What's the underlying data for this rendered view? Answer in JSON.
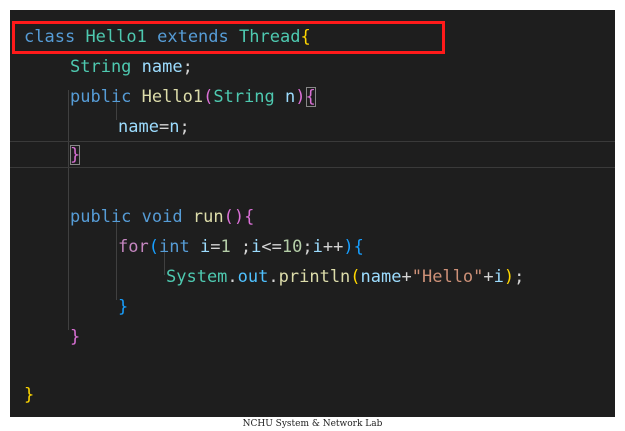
{
  "colors": {
    "background": "#1e1e1e",
    "keyword": "#569cd6",
    "type": "#4ec9b0",
    "function": "#dcdcaa",
    "variable": "#9cdcfe",
    "string": "#ce9178",
    "number": "#b5cea8",
    "brace_gold": "#ffd700",
    "brace_pink": "#da70d6",
    "brace_blue": "#179fff",
    "plain": "#d4d4d4",
    "highlight_box": "#ff1a1a"
  },
  "code": {
    "line1": {
      "kw": "class",
      "name": "Hello1",
      "extends": "extends",
      "type": "Thread",
      "brace": "{"
    },
    "line2": {
      "type": "String",
      "var": "name",
      "semi": ";"
    },
    "line3": {
      "kw": "public",
      "fn": "Hello1",
      "open": "(",
      "type": "String",
      "param": "n",
      "close": ")",
      "brace": "{"
    },
    "line4": {
      "var": "name",
      "op": "=",
      "param": "n",
      "semi": ";"
    },
    "line5": {
      "brace": "}"
    },
    "line6": {
      "kw": "public",
      "kw2": "void",
      "fn": "run",
      "parens": "()",
      "brace": "{"
    },
    "line7": {
      "kw": "for",
      "open": "(",
      "type": "int",
      "init_var": "i",
      "eq": "=",
      "num1": "1",
      "sep1": " ;",
      "cond_var": "i",
      "le": "<=",
      "num2": "10",
      "sep2": ";",
      "inc_var": "i",
      "inc": "++",
      "close": ")",
      "brace": "{"
    },
    "line8": {
      "obj": "System",
      "dot1": ".",
      "field": "out",
      "dot2": ".",
      "fn": "println",
      "open": "(",
      "var": "name",
      "plus1": "+",
      "str": "\"Hello\"",
      "plus2": "+",
      "ivar": "i",
      "close": ")",
      "semi": ";"
    },
    "line9": {
      "brace": "}"
    },
    "line10": {
      "brace": "}"
    },
    "line12": {
      "brace": "}"
    }
  },
  "footer": {
    "text": "NCHU System & Network Lab"
  }
}
